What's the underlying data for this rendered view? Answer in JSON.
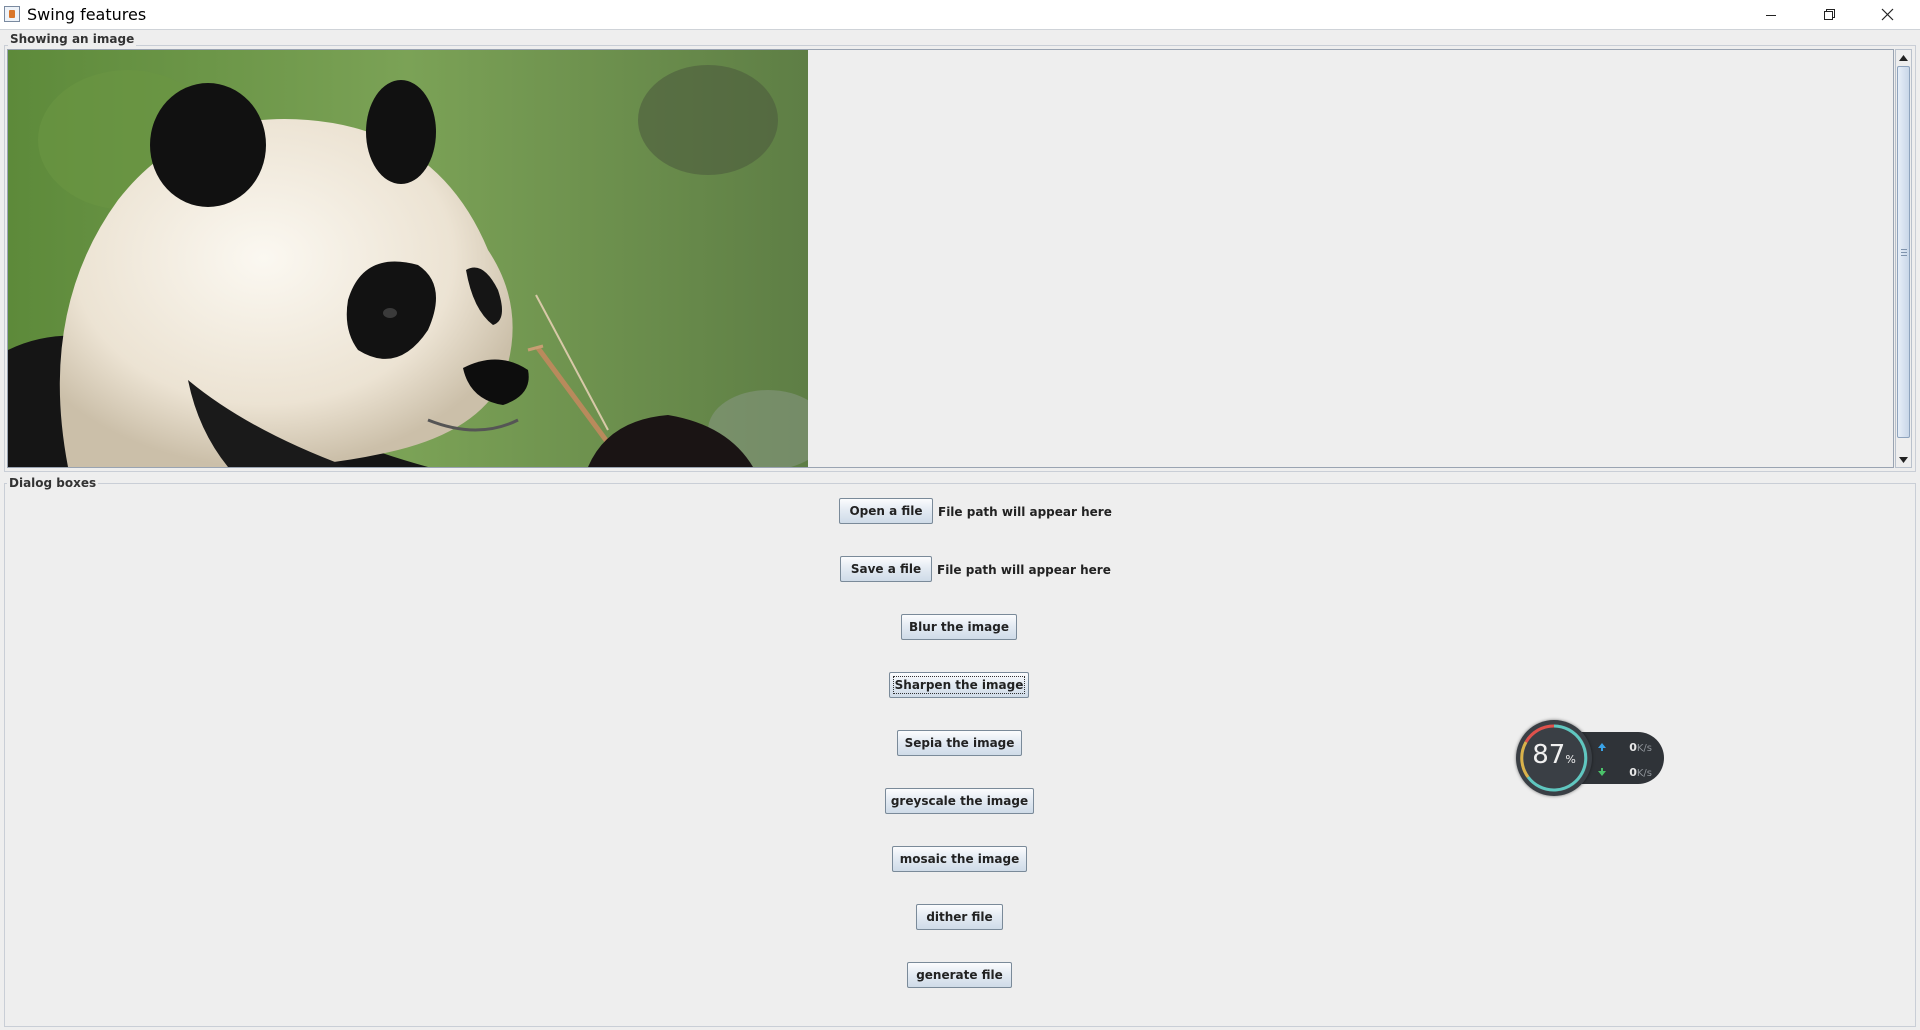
{
  "window": {
    "title": "Swing features",
    "minimize_icon": "minimize-icon",
    "restore_icon": "restore-icon",
    "close_icon": "close-icon"
  },
  "image_panel": {
    "title": "Showing an image",
    "image_subject": "panda-photo"
  },
  "dialog_panel": {
    "title": "Dialog boxes",
    "open_button": "Open a file",
    "open_path": "File path will appear here",
    "save_button": "Save a file",
    "save_path": "File path will appear here",
    "buttons": [
      "Blur the image",
      "Sharpen the image",
      "Sepia the image",
      "greyscale the image",
      "mosaic the image",
      "dither file",
      "generate file"
    ]
  },
  "net_widget": {
    "percent": "87",
    "percent_sign": "%",
    "upload_value": "0",
    "download_value": "0",
    "unit": "K/s"
  }
}
